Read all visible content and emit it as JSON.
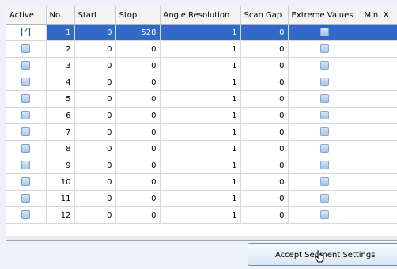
{
  "table": {
    "columns": [
      "Active",
      "No.",
      "Start",
      "Stop",
      "Angle Resolution",
      "Scan Gap",
      "Extreme Values",
      "Min. X"
    ],
    "rows": [
      {
        "active": true,
        "no": "1",
        "start": "0",
        "stop": "528",
        "angle_resolution": "1",
        "scan_gap": "0",
        "extreme_values": false,
        "selected": true
      },
      {
        "active": false,
        "no": "2",
        "start": "0",
        "stop": "0",
        "angle_resolution": "1",
        "scan_gap": "0",
        "extreme_values": false
      },
      {
        "active": false,
        "no": "3",
        "start": "0",
        "stop": "0",
        "angle_resolution": "1",
        "scan_gap": "0",
        "extreme_values": false
      },
      {
        "active": false,
        "no": "4",
        "start": "0",
        "stop": "0",
        "angle_resolution": "1",
        "scan_gap": "0",
        "extreme_values": false
      },
      {
        "active": false,
        "no": "5",
        "start": "0",
        "stop": "0",
        "angle_resolution": "1",
        "scan_gap": "0",
        "extreme_values": false
      },
      {
        "active": false,
        "no": "6",
        "start": "0",
        "stop": "0",
        "angle_resolution": "1",
        "scan_gap": "0",
        "extreme_values": false
      },
      {
        "active": false,
        "no": "7",
        "start": "0",
        "stop": "0",
        "angle_resolution": "1",
        "scan_gap": "0",
        "extreme_values": false
      },
      {
        "active": false,
        "no": "8",
        "start": "0",
        "stop": "0",
        "angle_resolution": "1",
        "scan_gap": "0",
        "extreme_values": false
      },
      {
        "active": false,
        "no": "9",
        "start": "0",
        "stop": "0",
        "angle_resolution": "1",
        "scan_gap": "0",
        "extreme_values": false
      },
      {
        "active": false,
        "no": "10",
        "start": "0",
        "stop": "0",
        "angle_resolution": "1",
        "scan_gap": "0",
        "extreme_values": false
      },
      {
        "active": false,
        "no": "11",
        "start": "0",
        "stop": "0",
        "angle_resolution": "1",
        "scan_gap": "0",
        "extreme_values": false
      },
      {
        "active": false,
        "no": "12",
        "start": "0",
        "stop": "0",
        "angle_resolution": "1",
        "scan_gap": "0",
        "extreme_values": false
      }
    ]
  },
  "accept_button": {
    "label": "Accept Segment Settings"
  },
  "colors": {
    "selection": "#3169c6",
    "grid_line": "#d4d8de"
  },
  "icons": {
    "cursor": "hand-pointer-icon",
    "checkbox": "checkbox-icon"
  }
}
